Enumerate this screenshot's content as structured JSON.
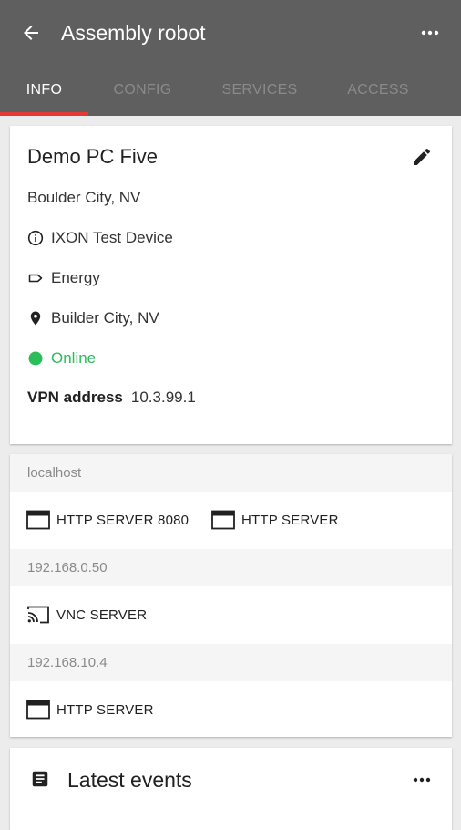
{
  "appbar": {
    "title": "Assembly robot",
    "back_icon": "arrow-back-icon",
    "more_icon": "more-horiz-icon"
  },
  "tabs": [
    {
      "label": "INFO",
      "active": true
    },
    {
      "label": "CONFIG",
      "active": false
    },
    {
      "label": "SERVICES",
      "active": false
    },
    {
      "label": "ACCESS",
      "active": false
    }
  ],
  "device": {
    "name": "Demo PC Five",
    "location_text": "Boulder City, NV",
    "type": "IXON Test Device",
    "tag": "Energy",
    "address": "Builder City, NV",
    "status": "Online",
    "vpn_label": "VPN address",
    "vpn_value": "10.3.99.1"
  },
  "hosts": [
    {
      "name": "localhost",
      "services": [
        {
          "label": "HTTP SERVER 8080",
          "icon": "browser-window-icon"
        },
        {
          "label": "HTTP SERVER",
          "icon": "browser-window-icon"
        }
      ]
    },
    {
      "name": "192.168.0.50",
      "services": [
        {
          "label": "VNC SERVER",
          "icon": "cast-icon"
        }
      ]
    },
    {
      "name": "192.168.10.4",
      "services": [
        {
          "label": "HTTP SERVER",
          "icon": "browser-window-icon"
        }
      ]
    }
  ],
  "events": {
    "title": "Latest events",
    "icon": "event-list-icon"
  },
  "colors": {
    "appbar": "#5f5f5f",
    "tab_indicator": "#e53935",
    "online": "#2bbd5a",
    "background": "#ececec"
  }
}
